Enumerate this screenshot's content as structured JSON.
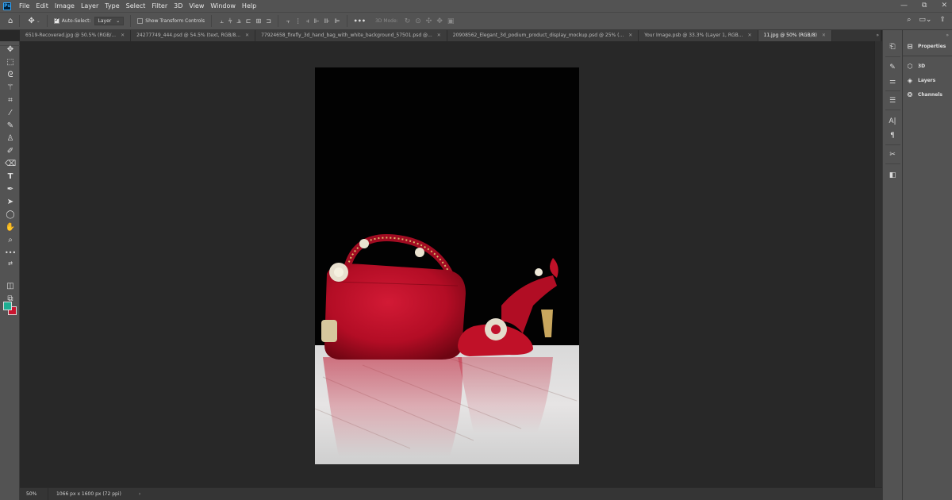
{
  "app": {
    "logo": "Ps",
    "menu": [
      "File",
      "Edit",
      "Image",
      "Layer",
      "Type",
      "Select",
      "Filter",
      "3D",
      "View",
      "Window",
      "Help"
    ],
    "window_controls": [
      "—",
      "⧉",
      "✕"
    ]
  },
  "options_bar": {
    "auto_select_label": "Auto-Select:",
    "auto_select_checked": true,
    "auto_select_target": "Layer",
    "show_transform_label": "Show Transform Controls",
    "show_transform_checked": false,
    "three_d_mode_label": "3D Mode:",
    "more_label": "•••"
  },
  "tabs": [
    {
      "label": "6519-Recovered.jpg @ 50.5% (RGB/...",
      "active": false
    },
    {
      "label": "24277749_444.psd @ 54.5% (text, RGB/8...",
      "active": false
    },
    {
      "label": "77924658_firefly_3d_hand_bag_with_white_background_57501.psd @...",
      "active": false
    },
    {
      "label": "20908562_Elegant_3d_podium_product_display_mockup.psd @ 25% (...",
      "active": false
    },
    {
      "label": "Your Image.psb @ 33.3% (Layer 1, RGB...",
      "active": false
    },
    {
      "label": "11.jpg @ 50% (RGB/8)",
      "active": true
    }
  ],
  "colors": {
    "foreground": "#1fae92",
    "background": "#c8152f"
  },
  "status": {
    "zoom": "50%",
    "doc_info": "1066 px x 1600 px (72 ppi)",
    "arrow": "›"
  },
  "right_panel": {
    "items": [
      {
        "label": "Properties",
        "icon": "properties-icon"
      },
      {
        "label": "3D",
        "icon": "cube-icon"
      },
      {
        "label": "Layers",
        "icon": "layers-icon"
      },
      {
        "label": "Channels",
        "icon": "channels-icon"
      }
    ]
  }
}
